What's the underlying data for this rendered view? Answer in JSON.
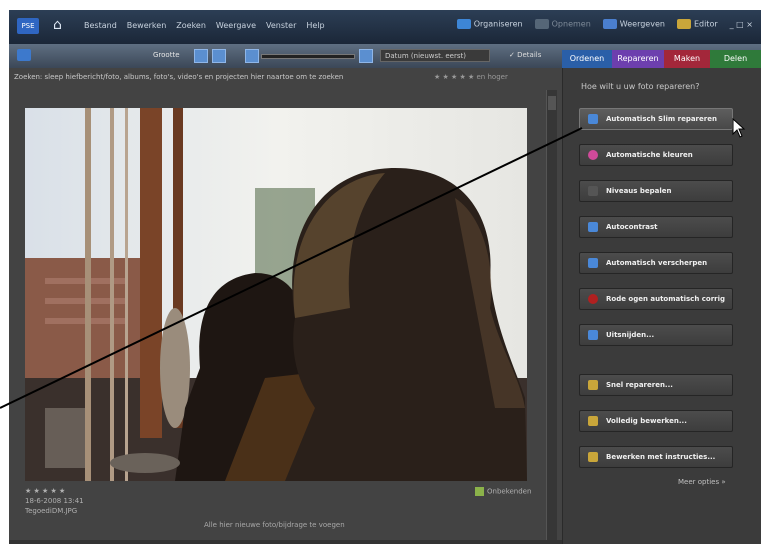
{
  "menubar": {
    "logo": "PSE",
    "home_icon": "home-icon",
    "menu_items": [
      "Bestand",
      "Bewerken",
      "Zoeken",
      "Weergave",
      "Venster",
      "Help"
    ],
    "right_items": [
      {
        "label": "Organiseren",
        "icon": "organize-icon",
        "color": "#3d86d6"
      },
      {
        "label": "Opnemen",
        "icon": "record-icon",
        "color": "#556677"
      },
      {
        "label": "Weergeven",
        "icon": "display-icon",
        "color": "#4a7fcf"
      },
      {
        "label": "Editor",
        "icon": "editor-icon",
        "color": "#c9a63a"
      }
    ],
    "window_controls": "_ □ ×"
  },
  "toolbar": {
    "label": "Grootte",
    "date_select": "Datum (nieuwst. eerst)",
    "details_label": "✓ Details"
  },
  "tabs": [
    {
      "label": "Ordenen",
      "color": "#2a5fa8"
    },
    {
      "label": "Repareren",
      "color": "#6d3fae"
    },
    {
      "label": "Maken",
      "color": "#a3273a"
    },
    {
      "label": "Delen",
      "color": "#2f7a3a"
    }
  ],
  "photo_area": {
    "info_text": "Zoeken: sleep hiefbericht/foto, albums, foto's, video's en projecten hier naartoe om te zoeken",
    "stars_right": "★ ★ ★ ★ ★ en hoger",
    "meta_stars": "★ ★ ★ ★ ★",
    "meta_date": "18-6-2008 13:41",
    "meta_file": "TegoediDM.JPG",
    "tag_label": "Onbekenden",
    "bottom_hint": "Alle hier nieuwe foto/bijdrage te voegen"
  },
  "panel": {
    "title": "Hoe wilt u uw foto repareren?",
    "buttons": [
      {
        "label": "Automatisch Slim repareren",
        "icon": "smart-fix-icon",
        "color": "#4a88d8"
      },
      {
        "label": "Automatische kleuren",
        "icon": "color-wheel-icon",
        "color": "#d04a9a"
      },
      {
        "label": "Niveaus bepalen",
        "icon": "levels-icon",
        "color": "#555555"
      },
      {
        "label": "Autocontrast",
        "icon": "contrast-icon",
        "color": "#4a88d8"
      },
      {
        "label": "Automatisch verscherpen",
        "icon": "sharpen-icon",
        "color": "#4a88d8"
      },
      {
        "label": "Rode ogen automatisch corrig",
        "icon": "red-eye-icon",
        "color": "#b02020"
      },
      {
        "label": "Uitsnijden...",
        "icon": "crop-icon",
        "color": "#4a88d8"
      },
      {
        "label": "Snel repareren...",
        "icon": "quick-fix-icon",
        "color": "#c9a63a"
      },
      {
        "label": "Volledig bewerken...",
        "icon": "full-edit-icon",
        "color": "#c9a63a"
      },
      {
        "label": "Bewerken met instructies...",
        "icon": "guided-edit-icon",
        "color": "#c9a63a"
      }
    ],
    "more_options": "Meer opties »"
  }
}
